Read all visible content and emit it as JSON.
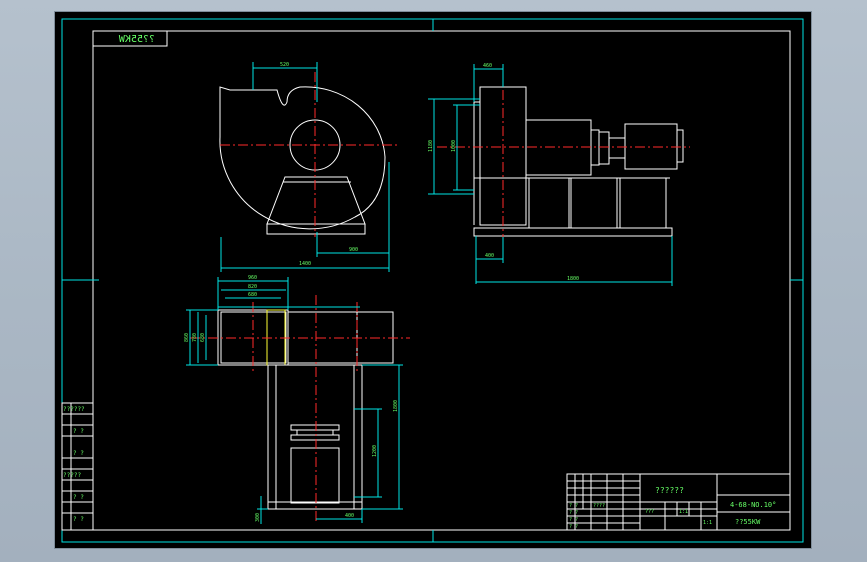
{
  "drawing": {
    "stamp_mirrored": "??55KW",
    "title_block": {
      "drawing_title": "??????",
      "model": "4-68-NO.10°",
      "power": "??55KW",
      "cells": {
        "r1": "????",
        "r2": "???",
        "scale": "1:1",
        "sheet": "1:1",
        "left_a": "? ?",
        "left_b": "? ?",
        "left_c": "? ?",
        "left_d": "? ?"
      }
    },
    "side_table": {
      "rows": [
        "??????",
        "? ?",
        "? ?",
        "?????",
        "? ?",
        "? ?"
      ]
    },
    "dimensions": {
      "front_top": "520",
      "front_bottom": "1400",
      "front_right": "900",
      "side_top": "460",
      "side_left_outer": "1180",
      "side_left_inner": "1000",
      "side_bottom_small": "400",
      "side_bottom": "1800",
      "plan_top_outer": "960",
      "plan_top_mid": "820",
      "plan_top_inner": "680",
      "plan_left_a": "860",
      "plan_left_b": "780",
      "plan_left_c": "680",
      "plan_right_outer": "1800",
      "plan_right_inner": "1200",
      "plan_bottom_left": "300",
      "plan_bottom_right": "400"
    }
  }
}
